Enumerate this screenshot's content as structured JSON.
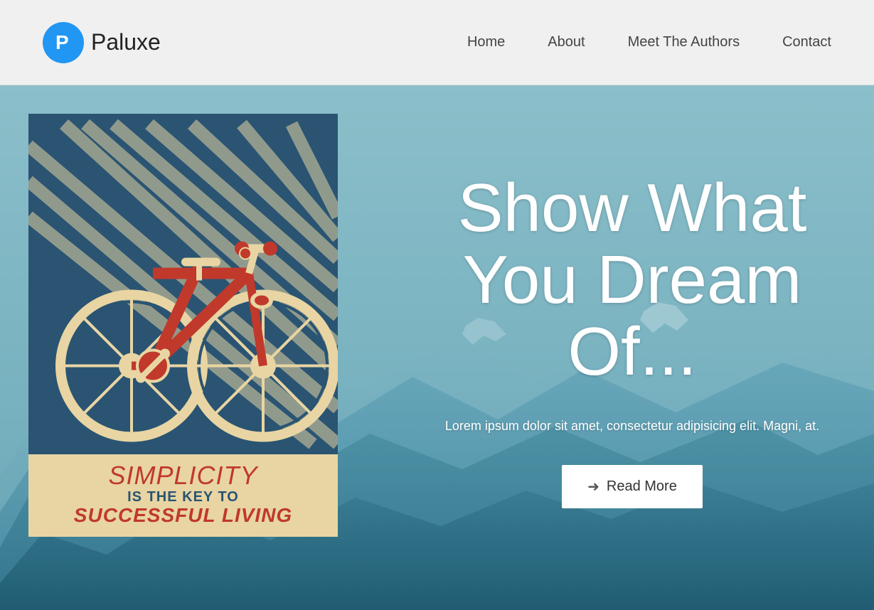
{
  "site": {
    "logo_text": "Paluxe"
  },
  "nav": {
    "items": [
      {
        "label": "Home",
        "id": "home"
      },
      {
        "label": "About",
        "id": "about"
      },
      {
        "label": "Meet The Authors",
        "id": "authors"
      },
      {
        "label": "Contact",
        "id": "contact"
      }
    ]
  },
  "hero": {
    "title": "Show What You Dream Of...",
    "subtitle": "Lorem ipsum dolor sit amet, consectetur adipisicing elit. Magni, at.",
    "cta_label": "Read More"
  },
  "poster": {
    "line1": "SIMPLICITY",
    "line2": "IS THE KEY TO",
    "line3": "SUCCESSFUL LIVING"
  }
}
